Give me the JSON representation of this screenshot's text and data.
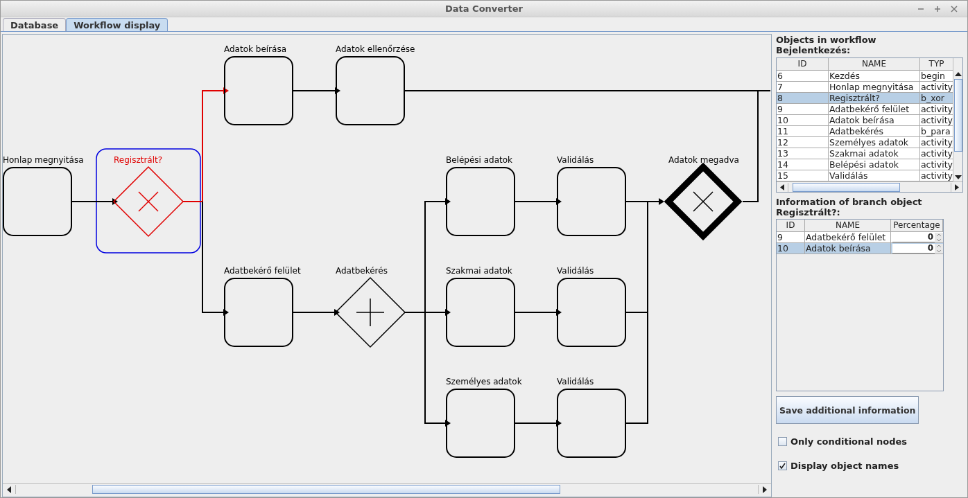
{
  "window": {
    "title": "Data Converter"
  },
  "tabs": [
    {
      "label": "Database",
      "selected": false
    },
    {
      "label": "Workflow display",
      "selected": true
    }
  ],
  "diagram": {
    "nodes": [
      {
        "kind": "activity",
        "label": "Adatok beírása",
        "selected": false
      },
      {
        "kind": "activity",
        "label": "Adatok ellenőrzése",
        "selected": false
      },
      {
        "kind": "activity",
        "label": "Honlap megnyitása",
        "selected": false
      },
      {
        "kind": "xor",
        "label": "Regisztrált?",
        "selected": true
      },
      {
        "kind": "activity",
        "label": "Belépési adatok",
        "selected": false
      },
      {
        "kind": "activity",
        "label": "Validálás",
        "selected": false
      },
      {
        "kind": "xor_join",
        "label": "Adatok megadva",
        "selected": false
      },
      {
        "kind": "activity",
        "label": "Adatbekérő felület",
        "selected": false
      },
      {
        "kind": "and",
        "label": "Adatbekérés",
        "selected": false
      },
      {
        "kind": "activity",
        "label": "Szakmai adatok",
        "selected": false
      },
      {
        "kind": "activity",
        "label": "Validálás",
        "selected": false
      },
      {
        "kind": "activity",
        "label": "Személyes adatok",
        "selected": false
      },
      {
        "kind": "activity",
        "label": "Validálás",
        "selected": false
      }
    ],
    "edges": [
      {
        "highlighted": false
      },
      {
        "highlighted": true
      },
      {
        "highlighted": false
      },
      {
        "highlighted": false
      },
      {
        "highlighted": false
      },
      {
        "highlighted": false
      },
      {
        "highlighted": false
      },
      {
        "highlighted": false
      },
      {
        "highlighted": false
      },
      {
        "highlighted": false
      },
      {
        "highlighted": false
      },
      {
        "highlighted": false
      },
      {
        "highlighted": false
      },
      {
        "highlighted": false
      },
      {
        "highlighted": false
      },
      {
        "highlighted": false
      }
    ]
  },
  "objects_panel": {
    "title": "Objects in workflow",
    "subtitle": "Bejelentkezés:",
    "columns": [
      "ID",
      "NAME",
      "TYP"
    ],
    "rows": [
      {
        "cells": [
          "6",
          "Kezdés",
          "begin"
        ],
        "selected": false
      },
      {
        "cells": [
          "7",
          "Honlap megnyitása",
          "activity"
        ],
        "selected": false
      },
      {
        "cells": [
          "8",
          "Regisztrált?",
          "b_xor"
        ],
        "selected": true
      },
      {
        "cells": [
          "9",
          "Adatbekérő felület",
          "activity"
        ],
        "selected": false
      },
      {
        "cells": [
          "10",
          "Adatok beírása",
          "activity"
        ],
        "selected": false
      },
      {
        "cells": [
          "11",
          "Adatbekérés",
          "b_para"
        ],
        "selected": false
      },
      {
        "cells": [
          "12",
          "Személyes adatok",
          "activity"
        ],
        "selected": false
      },
      {
        "cells": [
          "13",
          "Szakmai adatok",
          "activity"
        ],
        "selected": false
      },
      {
        "cells": [
          "14",
          "Belépési adatok",
          "activity"
        ],
        "selected": false
      },
      {
        "cells": [
          "15",
          "Validálás",
          "activity"
        ],
        "selected": false
      }
    ]
  },
  "branch_panel": {
    "title": "Information of branch object",
    "subtitle": "Regisztrált?:",
    "columns": [
      "ID",
      "NAME",
      "Percentage"
    ],
    "rows": [
      {
        "id": "9",
        "name": "Adatbekérő felület",
        "percentage": "0",
        "selected": false
      },
      {
        "id": "10",
        "name": "Adatok beírása",
        "percentage": "0",
        "selected": true
      }
    ]
  },
  "save_button": "Save additional information",
  "options": [
    {
      "label": "Only conditional nodes",
      "checked": false
    },
    {
      "label": "Display object names",
      "checked": true
    }
  ]
}
